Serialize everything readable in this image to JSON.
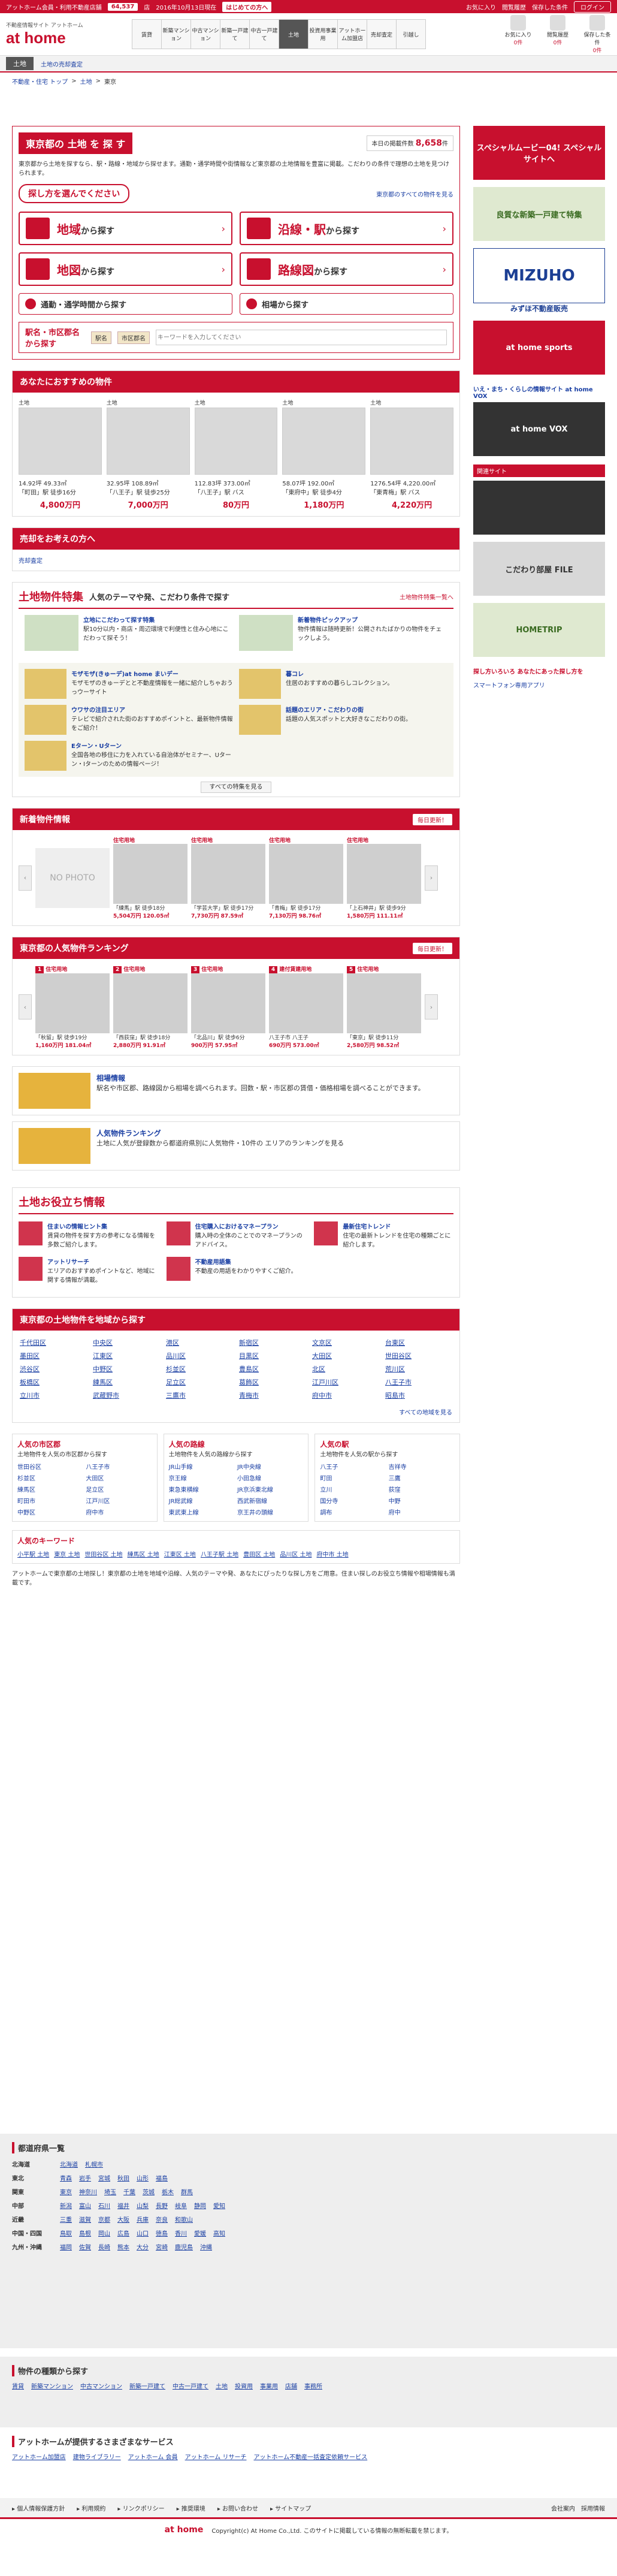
{
  "topbar": {
    "left1": "アットホーム会員・利用不動産店舗",
    "count": "64,537",
    "unit": "店",
    "date": "2016年10月13日現在",
    "badge": "はじめての方へ",
    "links": [
      "お気に入り",
      "閲覧履歴",
      "保存した条件"
    ],
    "login": "ログイン"
  },
  "header": {
    "tag": "不動産情報サイト アットホーム",
    "brand": "at home",
    "nav": [
      "賃貸",
      "新築マンション",
      "中古マンション",
      "新築一戸建て",
      "中古一戸建て",
      "土地",
      "投資用事業用",
      "アットホーム加盟店",
      "売却査定",
      "引越し"
    ],
    "icons": [
      "お気に入り",
      "閲覧履歴",
      "保存した条件"
    ],
    "icon_counts": [
      "0件",
      "0件",
      "0件"
    ]
  },
  "subhead": {
    "tab": "土地",
    "link": "土地の売却査定"
  },
  "breadcrumb": [
    "不動産・住宅 トップ",
    "土地",
    "東京"
  ],
  "hero": {
    "title": "東京都の 土地 を 探 す",
    "count_label": "本日の掲載件数",
    "count": "8,658",
    "count_unit": "件",
    "desc": "東京都から土地を探すなら、駅・路線・地域から探せます。通勤・通学時間や街情報など東京都の土地情報を豊富に掲載。こだわりの条件で理想の土地を見つけられます。",
    "seek": "探し方を選んでください",
    "all_link": "東京都のすべての物件を見る"
  },
  "search_buttons": [
    {
      "main": "地域",
      "sub": "から探す"
    },
    {
      "main": "沿線・駅",
      "sub": "から探す"
    },
    {
      "main": "地図",
      "sub": "から探す"
    },
    {
      "main": "路線図",
      "sub": "から探す"
    }
  ],
  "small_buttons": [
    "通勤・通学時間から探す",
    "相場から探す"
  ],
  "station_search": {
    "label": "駅名・市区郡名から探す",
    "chip1": "駅名",
    "chip2": "市区郡名",
    "placeholder": "キーワードを入力してください"
  },
  "recommend": {
    "title": "あなたにおすすめの物件",
    "items": [
      {
        "kind": "土地",
        "size": "14.92坪 49.33㎡",
        "place": "「町田」駅 徒歩16分",
        "price": "4,800万円"
      },
      {
        "kind": "土地",
        "size": "32.95坪 108.89㎡",
        "place": "「八王子」駅 徒歩25分",
        "price": "7,000万円"
      },
      {
        "kind": "土地",
        "size": "112.83坪 373.00㎡",
        "place": "「八王子」駅 バス",
        "price": "80万円"
      },
      {
        "kind": "土地",
        "size": "58.07坪 192.00㎡",
        "place": "「東府中」駅 徒歩4分",
        "price": "1,180万円"
      },
      {
        "kind": "土地",
        "size": "1276.54坪 4,220.00㎡",
        "place": "「東青梅」駅 バス",
        "price": "4,220万円"
      }
    ]
  },
  "seller": {
    "title": "売却をお考えの方へ",
    "link": "売却査定"
  },
  "feature": {
    "title": "土地物件特集",
    "subtitle": "人気のテーマや発、こだわり条件で探す",
    "right": "土地物件特集一覧へ",
    "top": [
      {
        "title": "立地にこだわって探す特集",
        "text": "駅10分以内・商店・周辺環境で利便性と住み心地にこだわって探そう！"
      },
      {
        "title": "新着物件ピックアップ",
        "text": "物件情報は随時更新！公開されたばかりの物件をチェックしよう。"
      }
    ],
    "items": [
      {
        "title": "モザモザ(きゅーデ)at home まいデー",
        "text": "モザモザのきゅーデとと不動産情報を一緒に紹介しちゃおうっウーサイト"
      },
      {
        "title": "ウワサの注目エリア",
        "text": ""
      },
      {
        "title": "テレビで紹介された街のおすすめポイントと、最新物件情報をご紹介！",
        "text": ""
      },
      {
        "title": "暮コレ",
        "text": "住居のおすすめの暮らしコレクション。"
      },
      {
        "title": "Eターン・Uターン",
        "text": "全国各地の移住に力を入れている自治体がセミナー、Uターン・Iターンのための情報ページ！"
      },
      {
        "title": "話題のエリア・こだわりの街",
        "text": "話題の人気スポットと大好きなこだわりの街。"
      }
    ],
    "more": "すべての特集を見る"
  },
  "newlist": {
    "title": "新着物件情報",
    "right": "毎日更新！",
    "items": [
      {
        "type": "",
        "place": "",
        "price": "",
        "size": "",
        "photo": "NO PHOTO"
      },
      {
        "type": "住宅用地",
        "place": "「練馬」駅 徒歩18分",
        "price": "5,504万円 120.05㎡",
        "size": "",
        "photo": ""
      },
      {
        "type": "住宅用地",
        "place": "「学芸大学」駅 徒歩17分",
        "price": "7,730万円 87.59㎡",
        "size": "",
        "photo": ""
      },
      {
        "type": "住宅用地",
        "place": "「青梅」駅 徒歩17分",
        "price": "7,130万円 98.76㎡",
        "size": "",
        "photo": ""
      },
      {
        "type": "住宅用地",
        "place": "「上石神井」駅 徒歩9分",
        "price": "1,580万円 111.11㎡",
        "size": "",
        "photo": ""
      }
    ]
  },
  "ranking": {
    "title": "東京都の人気物件ランキング",
    "right": "毎日更新！",
    "items": [
      {
        "type": "住宅用地",
        "place": "「秋留」駅 徒歩19分",
        "price": "1,160万円 181.04㎡"
      },
      {
        "type": "住宅用地",
        "place": "「西荻窪」駅 徒歩18分",
        "price": "2,880万円 91.91㎡"
      },
      {
        "type": "住宅用地",
        "place": "「北品川」駅 徒歩6分",
        "price": "900万円 57.95㎡"
      },
      {
        "type": "建付賃建用地",
        "place": "八王子市 八王子",
        "price": "690万円 573.00㎡"
      },
      {
        "type": "住宅用地",
        "place": "「東京」駅 徒歩11分",
        "price": "2,580万円 98.52㎡"
      }
    ]
  },
  "info": [
    {
      "title": "相場情報",
      "text": "駅名や市区郡、路線図から相場を調べられます。回数・駅・市区郡の賃借・価格相場を調べることができます。"
    },
    {
      "title": "人気物件ランキング",
      "text": "土地に人気が登録数から都道府県別に人気物件・10件の エリアのランキングを見る"
    }
  ],
  "useful": {
    "title": "土地お役立ち情報",
    "items": [
      {
        "title": "住まいの情報ヒント集",
        "text": "賃貸の物件を探す方の参考になる情報を多数ご紹介します。"
      },
      {
        "title": "住宅購入におけるマネープラン",
        "text": "購入時の全体のことでのマネープランのアドバイス。"
      },
      {
        "title": "最新住宅トレンド",
        "text": "住宅の最新トレンドを住宅の種類ごとに紹介します。"
      },
      {
        "title": "アットリサーチ",
        "text": "エリアのおすすめポイントなど、地域に関する情報が満載。"
      },
      {
        "title": "不動産用語集",
        "text": "不動産の用語をわかりやすくご紹介。"
      }
    ]
  },
  "areas": {
    "title": "東京都の土地物件を地域から探す",
    "list": [
      "千代田区",
      "中央区",
      "港区",
      "新宿区",
      "文京区",
      "台東区",
      "墨田区",
      "江東区",
      "品川区",
      "目黒区",
      "大田区",
      "世田谷区",
      "渋谷区",
      "中野区",
      "杉並区",
      "豊島区",
      "北区",
      "荒川区",
      "板橋区",
      "練馬区",
      "足立区",
      "葛飾区",
      "江戸川区",
      "八王子市",
      "立川市",
      "武蔵野市",
      "三鷹市",
      "青梅市",
      "府中市",
      "昭島市"
    ],
    "more": "すべての地域を見る"
  },
  "popular": [
    {
      "title": "人気の市区郡",
      "sub": "土地物件を人気の市区郡から探す",
      "items": [
        "世田谷区",
        "八王子市",
        "杉並区",
        "大田区",
        "練馬区",
        "足立区",
        "町田市",
        "江戸川区",
        "中野区",
        "府中市"
      ]
    },
    {
      "title": "人気の路線",
      "sub": "土地物件を人気の路線から探す",
      "items": [
        "JR山手線",
        "JR中央線",
        "京王線",
        "小田急線",
        "東急東横線",
        "JR京浜東北線",
        "JR総武線",
        "西武新宿線",
        "東武東上線",
        "京王井の頭線"
      ]
    },
    {
      "title": "人気の駅",
      "sub": "土地物件を人気の駅から探す",
      "items": [
        "八王子",
        "吉祥寺",
        "町田",
        "三鷹",
        "立川",
        "荻窪",
        "国分寺",
        "中野",
        "調布",
        "府中"
      ]
    }
  ],
  "keywords": {
    "title": "人気のキーワード",
    "items": [
      "小平駅 土地",
      "東京 土地",
      "世田谷区 土地",
      "練馬区 土地",
      "江東区 土地",
      "八王子駅 土地",
      "豊田区 土地",
      "品川区 土地",
      "府中市 土地"
    ]
  },
  "description": "アットホームで東京都の土地探し！東京都の土地を地域や沿線、人気のテーマや発、あなたにぴったりな探し方をご用意。住まい探しのお役立ち情報や相場情報も満載です。",
  "side": {
    "banner1": "スペシャルムービー04! スペシャルサイトへ",
    "banner2": "良質な新築一戸建て特集",
    "banner3": "MIZUHO",
    "banner3sub": "みずほ不動産販売",
    "sports": "at home sports",
    "vox_title": "いえ・まち・くらしの情報サイト at home VOX",
    "vox_link": "at home VOX",
    "related": "関連サイト",
    "banner4": "こだわり部屋 FILE",
    "banner5": "HOMETRIP",
    "app_title": "探し方いろいろ あなたにあった探し方を",
    "app_link": "スマートフォン専用アプリ"
  },
  "prefs": {
    "title": "都道府県一覧",
    "rows": [
      {
        "region": "北海道",
        "prefs": [
          "北海道",
          "札幌市"
        ]
      },
      {
        "region": "東北",
        "prefs": [
          "青森",
          "岩手",
          "宮城",
          "秋田",
          "山形",
          "福島"
        ]
      },
      {
        "region": "関東",
        "prefs": [
          "東京",
          "神奈川",
          "埼玉",
          "千葉",
          "茨城",
          "栃木",
          "群馬"
        ]
      },
      {
        "region": "中部",
        "prefs": [
          "新潟",
          "富山",
          "石川",
          "福井",
          "山梨",
          "長野",
          "岐阜",
          "静岡",
          "愛知"
        ]
      },
      {
        "region": "近畿",
        "prefs": [
          "三重",
          "滋賀",
          "京都",
          "大阪",
          "兵庫",
          "奈良",
          "和歌山"
        ]
      },
      {
        "region": "中国・四国",
        "prefs": [
          "鳥取",
          "島根",
          "岡山",
          "広島",
          "山口",
          "徳島",
          "香川",
          "愛媛",
          "高知"
        ]
      },
      {
        "region": "九州・沖縄",
        "prefs": [
          "福岡",
          "佐賀",
          "長崎",
          "熊本",
          "大分",
          "宮崎",
          "鹿児島",
          "沖縄"
        ]
      }
    ]
  },
  "types": {
    "title": "物件の種類から探す",
    "items": [
      "賃貸",
      "新築マンション",
      "中古マンション",
      "新築一戸建て",
      "中古一戸建て",
      "土地",
      "投資用",
      "事業用",
      "店舗",
      "事務所"
    ]
  },
  "services": {
    "title": "アットホームが提供するさまざまなサービス",
    "items": [
      "アットホーム加盟店",
      "建物ライブラリー",
      "アットホーム 会員",
      "アットホーム リサーチ",
      "アットホーム不動産一括査定依頼サービス"
    ]
  },
  "footer_nav": [
    "個人情報保護方針",
    "利用規約",
    "リンクポリシー",
    "推奨環境",
    "お問い合わせ",
    "サイトマップ"
  ],
  "footer_right": [
    "会社案内",
    "採用情報"
  ],
  "copyright": "Copyright(c) At Home Co.,Ltd. このサイトに掲載している情報の無断転載を禁じます。"
}
